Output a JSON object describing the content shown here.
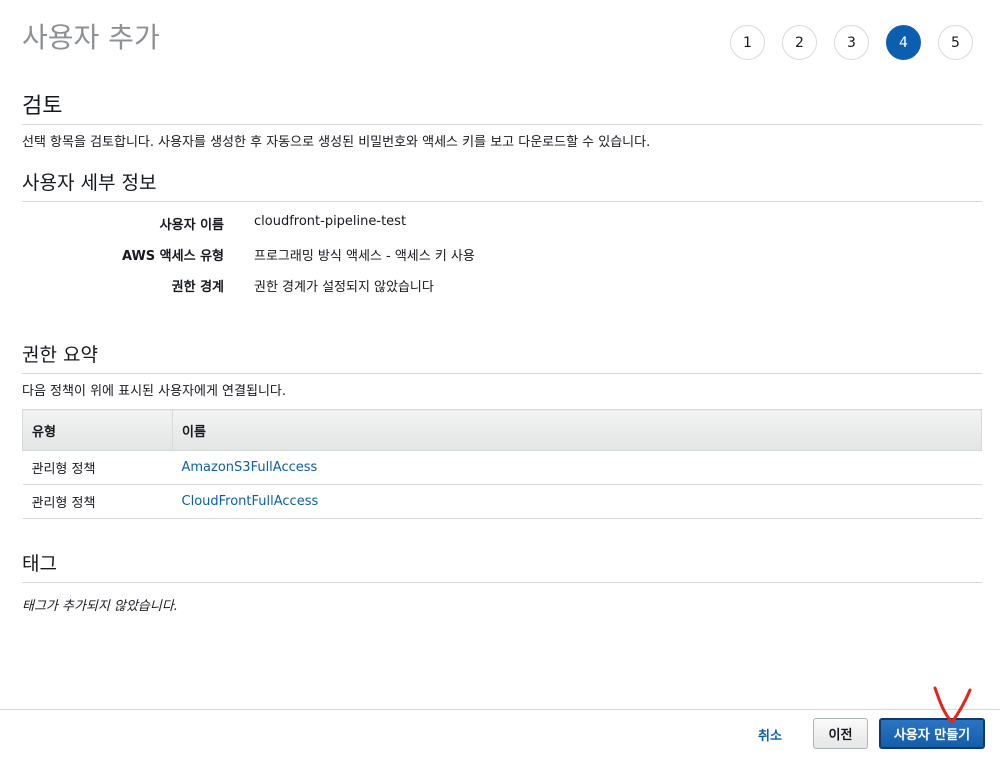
{
  "page_title": "사용자 추가",
  "steps": [
    "1",
    "2",
    "3",
    "4",
    "5"
  ],
  "active_step": "4",
  "review": {
    "title": "검토",
    "description": "선택 항목을 검토합니다. 사용자를 생성한 후 자동으로 생성된 비밀번호와 액세스 키를 보고 다운로드할 수 있습니다."
  },
  "user_details": {
    "title": "사용자 세부 정보",
    "rows": [
      {
        "label": "사용자 이름",
        "value": "cloudfront-pipeline-test"
      },
      {
        "label": "AWS 액세스 유형",
        "value": "프로그래밍 방식 액세스 - 액세스 키 사용"
      },
      {
        "label": "권한 경계",
        "value": "권한 경계가 설정되지 않았습니다"
      }
    ]
  },
  "permissions": {
    "title": "권한 요약",
    "description": "다음 정책이 위에 표시된 사용자에게 연결됩니다.",
    "columns": [
      "유형",
      "이름"
    ],
    "rows": [
      {
        "type": "관리형 정책",
        "name": "AmazonS3FullAccess"
      },
      {
        "type": "관리형 정책",
        "name": "CloudFrontFullAccess"
      }
    ]
  },
  "tags": {
    "title": "태그",
    "empty_text": "태그가 추가되지 않았습니다."
  },
  "footer": {
    "cancel_label": "취소",
    "previous_label": "이전",
    "create_label": "사용자 만들기"
  },
  "colors": {
    "accent": "#0b5fae",
    "annotation": "#e8231a"
  }
}
